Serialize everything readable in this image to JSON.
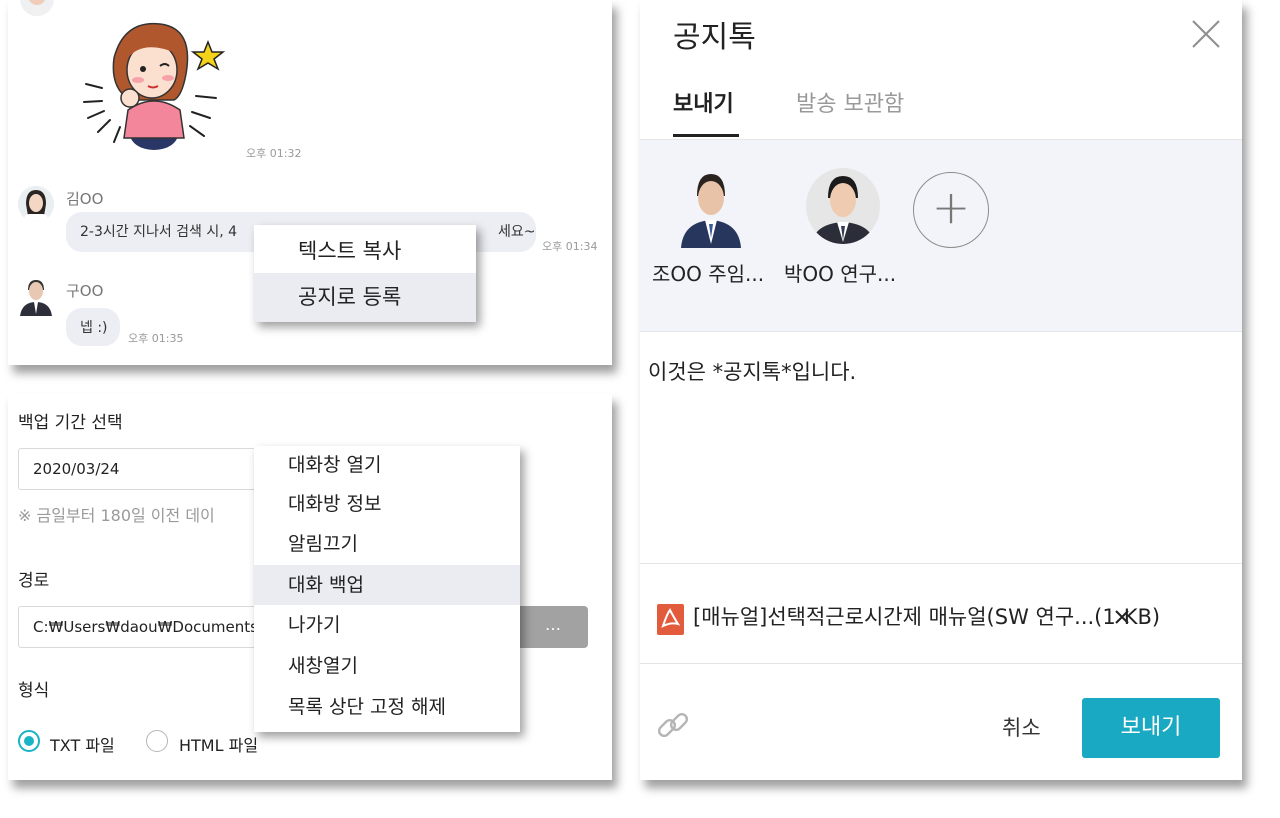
{
  "chat": {
    "messages": [
      {
        "time": "오후 01:32"
      },
      {
        "sender": "김OO",
        "text": "2-3시간 지나서 검색 시, 4",
        "text_end": "세요~",
        "time": "오후 01:34"
      },
      {
        "sender": "구OO",
        "text": "넵 :)",
        "time": "오후 01:35"
      }
    ],
    "context_menu": {
      "items": [
        {
          "label": "텍스트 복사"
        },
        {
          "label": "공지로 등록",
          "highlighted": true
        }
      ]
    }
  },
  "backup": {
    "period_label": "백업 기간 선택",
    "date_value": "2020/03/24",
    "note": "※ 금일부터 180일 이전 데이",
    "path_label": "경로",
    "path_value": "C:₩Users₩daou₩Documents",
    "browse_label": "…",
    "format_label": "형식",
    "formats": [
      {
        "label": "TXT 파일",
        "selected": true
      },
      {
        "label": "HTML 파일",
        "selected": false
      }
    ]
  },
  "room_menu": {
    "items": [
      {
        "label": "대화창 열기"
      },
      {
        "label": "대화방 정보"
      },
      {
        "label": "알림끄기"
      },
      {
        "label": "대화 백업",
        "highlighted": true
      },
      {
        "label": "나가기"
      },
      {
        "label": "새창열기"
      },
      {
        "label": "목록 상단 고정 해제"
      }
    ]
  },
  "notice": {
    "title": "공지톡",
    "close_icon": "close-icon",
    "tabs": [
      {
        "label": "보내기",
        "active": true
      },
      {
        "label": "발송 보관함",
        "active": false
      }
    ],
    "recipients": [
      {
        "name": "조OO 주임..."
      },
      {
        "name": "박OO 연구..."
      }
    ],
    "add_label": "+",
    "message": "이것은 *공지톡*입니다.",
    "attachment": {
      "icon": "pdf-icon",
      "label": "[매뉴얼]선택적근로시간제 매뉴얼(SW 연구...(1",
      "size": "KB)",
      "remove_icon": "close-icon"
    },
    "link_icon": "link-icon",
    "cancel_label": "취소",
    "send_label": "보내기"
  },
  "colors": {
    "accent": "#1aa9c2",
    "radio": "#1bb3c6",
    "pdf": "#e15b3c",
    "bubble": "#eceef4",
    "highlight": "#eaecf2"
  }
}
